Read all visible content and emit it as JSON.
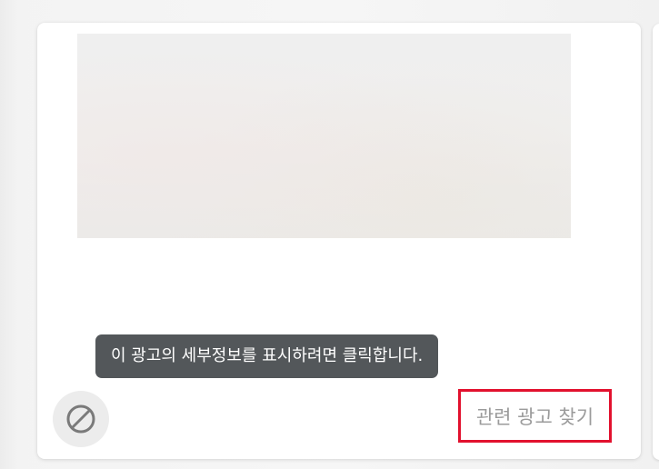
{
  "ad": {
    "tooltip_text": "이 광고의 세부정보를 표시하려면 클릭합니다.",
    "related_ads_label": "관련 광고 찾기",
    "block_icon": "block-icon"
  },
  "colors": {
    "tooltip_bg": "#53575a",
    "highlight_border": "#e2112e",
    "link_text": "#9b9b9b",
    "block_button_bg": "#ececec"
  }
}
